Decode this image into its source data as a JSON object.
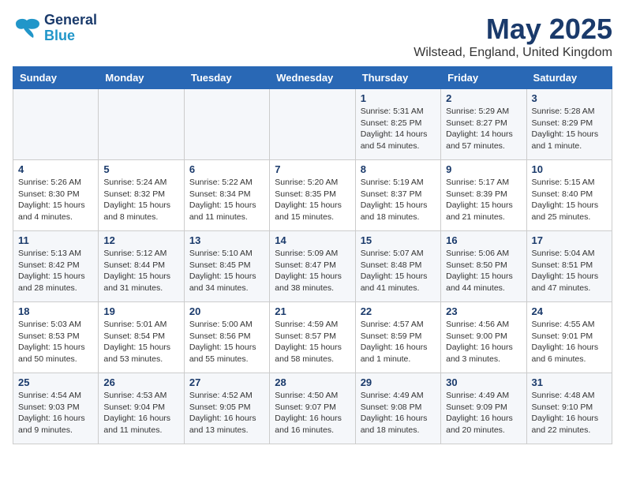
{
  "header": {
    "logo_line1": "General",
    "logo_line2": "Blue",
    "title": "May 2025",
    "subtitle": "Wilstead, England, United Kingdom"
  },
  "weekdays": [
    "Sunday",
    "Monday",
    "Tuesday",
    "Wednesday",
    "Thursday",
    "Friday",
    "Saturday"
  ],
  "weeks": [
    [
      {
        "day": "",
        "info": ""
      },
      {
        "day": "",
        "info": ""
      },
      {
        "day": "",
        "info": ""
      },
      {
        "day": "",
        "info": ""
      },
      {
        "day": "1",
        "info": "Sunrise: 5:31 AM\nSunset: 8:25 PM\nDaylight: 14 hours and 54 minutes."
      },
      {
        "day": "2",
        "info": "Sunrise: 5:29 AM\nSunset: 8:27 PM\nDaylight: 14 hours and 57 minutes."
      },
      {
        "day": "3",
        "info": "Sunrise: 5:28 AM\nSunset: 8:29 PM\nDaylight: 15 hours and 1 minute."
      }
    ],
    [
      {
        "day": "4",
        "info": "Sunrise: 5:26 AM\nSunset: 8:30 PM\nDaylight: 15 hours and 4 minutes."
      },
      {
        "day": "5",
        "info": "Sunrise: 5:24 AM\nSunset: 8:32 PM\nDaylight: 15 hours and 8 minutes."
      },
      {
        "day": "6",
        "info": "Sunrise: 5:22 AM\nSunset: 8:34 PM\nDaylight: 15 hours and 11 minutes."
      },
      {
        "day": "7",
        "info": "Sunrise: 5:20 AM\nSunset: 8:35 PM\nDaylight: 15 hours and 15 minutes."
      },
      {
        "day": "8",
        "info": "Sunrise: 5:19 AM\nSunset: 8:37 PM\nDaylight: 15 hours and 18 minutes."
      },
      {
        "day": "9",
        "info": "Sunrise: 5:17 AM\nSunset: 8:39 PM\nDaylight: 15 hours and 21 minutes."
      },
      {
        "day": "10",
        "info": "Sunrise: 5:15 AM\nSunset: 8:40 PM\nDaylight: 15 hours and 25 minutes."
      }
    ],
    [
      {
        "day": "11",
        "info": "Sunrise: 5:13 AM\nSunset: 8:42 PM\nDaylight: 15 hours and 28 minutes."
      },
      {
        "day": "12",
        "info": "Sunrise: 5:12 AM\nSunset: 8:44 PM\nDaylight: 15 hours and 31 minutes."
      },
      {
        "day": "13",
        "info": "Sunrise: 5:10 AM\nSunset: 8:45 PM\nDaylight: 15 hours and 34 minutes."
      },
      {
        "day": "14",
        "info": "Sunrise: 5:09 AM\nSunset: 8:47 PM\nDaylight: 15 hours and 38 minutes."
      },
      {
        "day": "15",
        "info": "Sunrise: 5:07 AM\nSunset: 8:48 PM\nDaylight: 15 hours and 41 minutes."
      },
      {
        "day": "16",
        "info": "Sunrise: 5:06 AM\nSunset: 8:50 PM\nDaylight: 15 hours and 44 minutes."
      },
      {
        "day": "17",
        "info": "Sunrise: 5:04 AM\nSunset: 8:51 PM\nDaylight: 15 hours and 47 minutes."
      }
    ],
    [
      {
        "day": "18",
        "info": "Sunrise: 5:03 AM\nSunset: 8:53 PM\nDaylight: 15 hours and 50 minutes."
      },
      {
        "day": "19",
        "info": "Sunrise: 5:01 AM\nSunset: 8:54 PM\nDaylight: 15 hours and 53 minutes."
      },
      {
        "day": "20",
        "info": "Sunrise: 5:00 AM\nSunset: 8:56 PM\nDaylight: 15 hours and 55 minutes."
      },
      {
        "day": "21",
        "info": "Sunrise: 4:59 AM\nSunset: 8:57 PM\nDaylight: 15 hours and 58 minutes."
      },
      {
        "day": "22",
        "info": "Sunrise: 4:57 AM\nSunset: 8:59 PM\nDaylight: 16 hours and 1 minute."
      },
      {
        "day": "23",
        "info": "Sunrise: 4:56 AM\nSunset: 9:00 PM\nDaylight: 16 hours and 3 minutes."
      },
      {
        "day": "24",
        "info": "Sunrise: 4:55 AM\nSunset: 9:01 PM\nDaylight: 16 hours and 6 minutes."
      }
    ],
    [
      {
        "day": "25",
        "info": "Sunrise: 4:54 AM\nSunset: 9:03 PM\nDaylight: 16 hours and 9 minutes."
      },
      {
        "day": "26",
        "info": "Sunrise: 4:53 AM\nSunset: 9:04 PM\nDaylight: 16 hours and 11 minutes."
      },
      {
        "day": "27",
        "info": "Sunrise: 4:52 AM\nSunset: 9:05 PM\nDaylight: 16 hours and 13 minutes."
      },
      {
        "day": "28",
        "info": "Sunrise: 4:50 AM\nSunset: 9:07 PM\nDaylight: 16 hours and 16 minutes."
      },
      {
        "day": "29",
        "info": "Sunrise: 4:49 AM\nSunset: 9:08 PM\nDaylight: 16 hours and 18 minutes."
      },
      {
        "day": "30",
        "info": "Sunrise: 4:49 AM\nSunset: 9:09 PM\nDaylight: 16 hours and 20 minutes."
      },
      {
        "day": "31",
        "info": "Sunrise: 4:48 AM\nSunset: 9:10 PM\nDaylight: 16 hours and 22 minutes."
      }
    ]
  ]
}
